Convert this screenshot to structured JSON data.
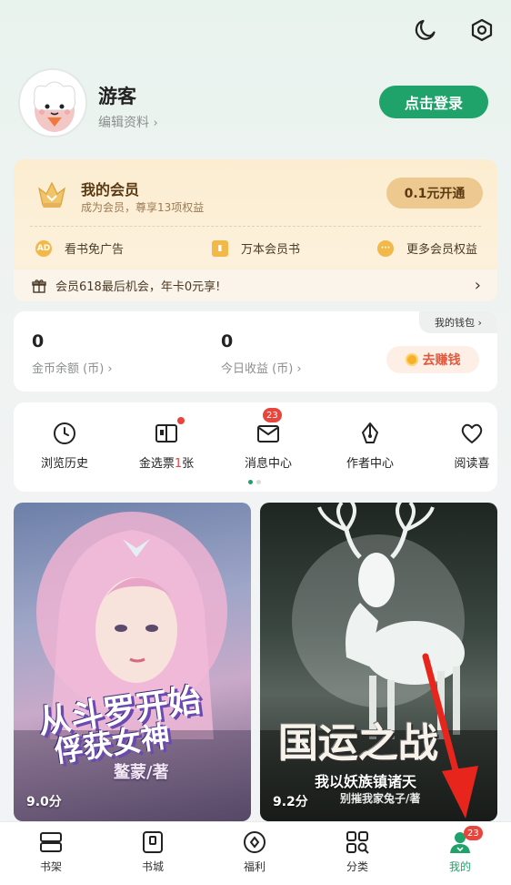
{
  "header": {
    "icons": [
      "moon-icon",
      "settings-hexagon-icon"
    ]
  },
  "profile": {
    "name": "游客",
    "edit_label": "编辑资料",
    "login_label": "点击登录"
  },
  "vip": {
    "title": "我的会员",
    "subtitle": "成为会员，尊享13项权益",
    "button": "0.1元开通",
    "perks": [
      {
        "label": "看书免广告",
        "icon": "ad-free-icon"
      },
      {
        "label": "万本会员书",
        "icon": "vip-book-icon"
      },
      {
        "label": "更多会员权益",
        "icon": "more-icon"
      }
    ],
    "banner": "会员618最后机会，年卡0元享!"
  },
  "wallet": {
    "tag": "我的钱包",
    "coin_value": "0",
    "coin_label": "金币余额 (币)",
    "today_value": "0",
    "today_label": "今日收益 (币)",
    "earn_button": "去赚钱"
  },
  "shortcuts": [
    {
      "label": "浏览历史",
      "icon": "clock-icon"
    },
    {
      "label_pre": "金选票",
      "label_num": "1",
      "label_post": "张",
      "icon": "ticket-icon"
    },
    {
      "label": "消息中心",
      "icon": "mail-icon",
      "badge": "23"
    },
    {
      "label": "作者中心",
      "icon": "pen-nib-icon"
    },
    {
      "label": "阅读喜",
      "icon": "heart-icon"
    }
  ],
  "books": [
    {
      "title_line1": "从斗罗开始",
      "title_line2": "俘获女神",
      "author": "鳌蒙/著",
      "rating": "9.0分"
    },
    {
      "title_line1": "国运之战",
      "title_line2": "我以妖族镇诸天",
      "author": "别摧我家兔子/著",
      "rating": "9.2分"
    }
  ],
  "nav": {
    "items": [
      {
        "label": "书架",
        "icon": "bookshelf-icon"
      },
      {
        "label": "书城",
        "icon": "bookstore-icon"
      },
      {
        "label": "福利",
        "icon": "welfare-icon"
      },
      {
        "label": "分类",
        "icon": "category-icon"
      },
      {
        "label": "我的",
        "icon": "profile-icon",
        "badge": "23"
      }
    ]
  },
  "colors": {
    "accent": "#1fa36b",
    "vip_gold": "#edc98f",
    "badge_red": "#e8453c",
    "earn_red": "#e4573a"
  }
}
